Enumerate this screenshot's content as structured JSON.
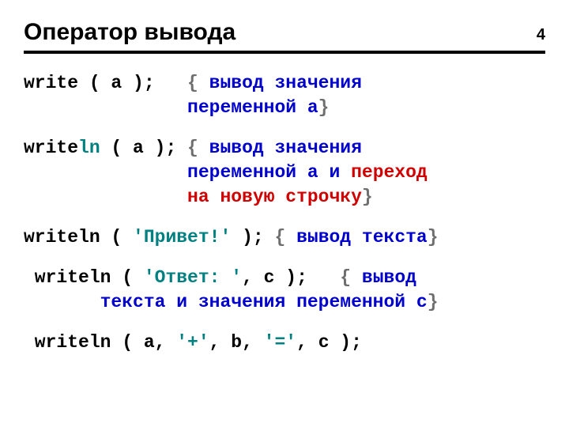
{
  "page_number": "4",
  "title": "Оператор вывода",
  "lines": {
    "l1a": "write ( a );   ",
    "l1b_open": "{ ",
    "l1b_text": "вывод значения",
    "l1c_text": "               переменной a",
    "l1c_close": "}",
    "l2a": "write",
    "l2a_ln": "ln",
    "l2a_tail": " ( a ); ",
    "l2b_open": "{ ",
    "l2b_text": "вывод значения",
    "l2c_pref": "               ",
    "l2c_text": "переменной a и ",
    "l2c_red": "переход",
    "l2d_pref": "               ",
    "l2d_red": "на новую строчку",
    "l2d_close": "}",
    "l3a": "writeln ( ",
    "l3b_str": "'Привет!'",
    "l3c": " ); ",
    "l3d_open": "{ ",
    "l3d_text": "вывод текста",
    "l3d_close": "}",
    "l4a": " writeln ( ",
    "l4b_str": "'Ответ: '",
    "l4c": ", c );   ",
    "l4d_open": "{ ",
    "l4d_text": "вывод",
    "l4e_pref": "       ",
    "l4e_text": "текста и значения переменной c",
    "l4e_close": "}",
    "l5": " writeln ( a, ",
    "l5b": "'+'",
    "l5c": ", b, ",
    "l5d": "'='",
    "l5e": ", c );"
  }
}
